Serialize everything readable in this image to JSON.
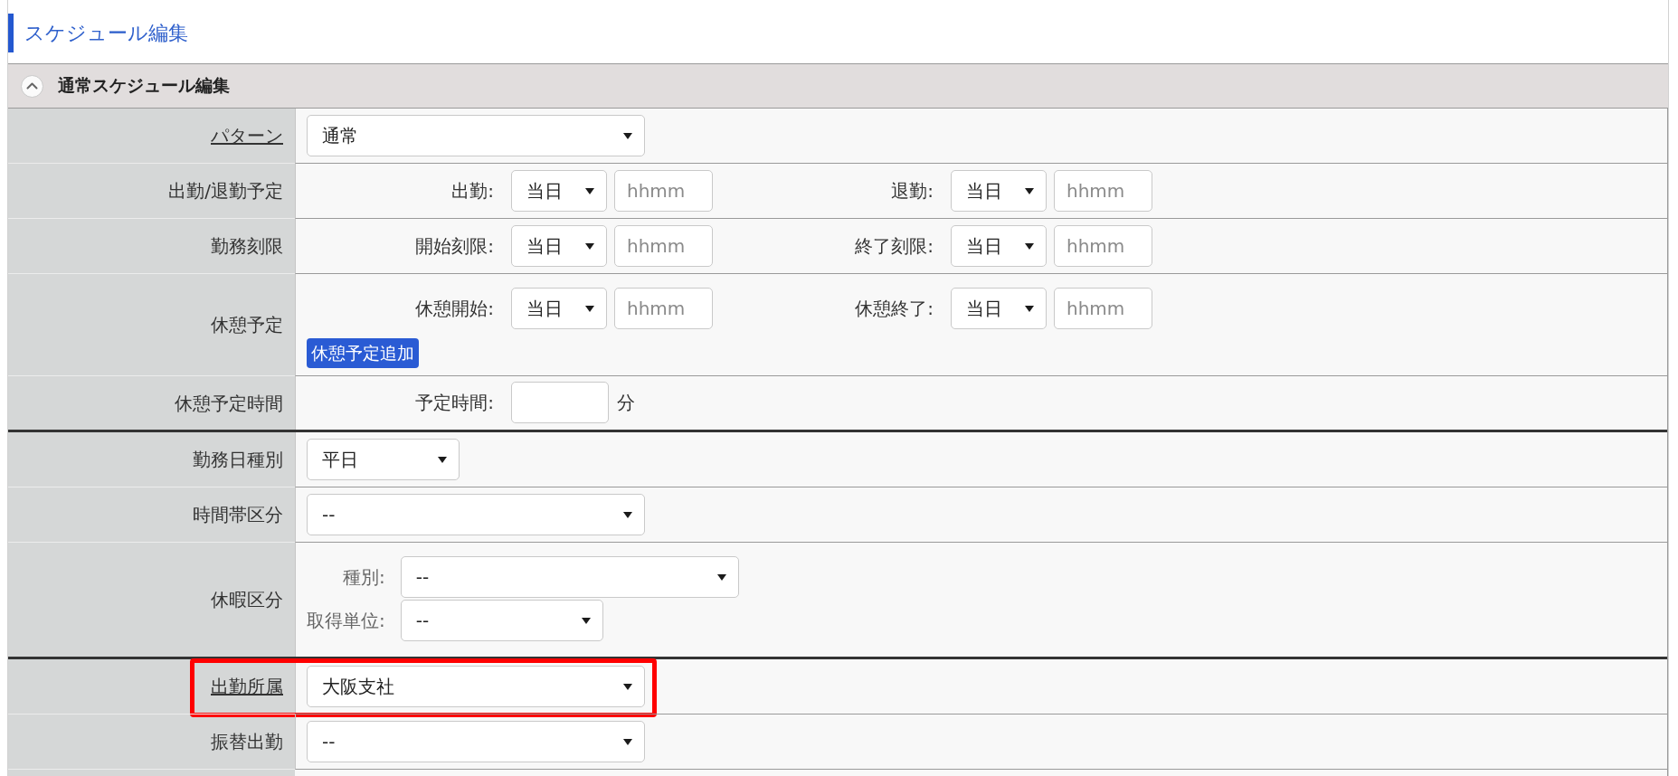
{
  "page_title": "スケジュール編集",
  "section": {
    "title": "通常スケジュール編集",
    "expanded": true,
    "groups": [
      {
        "rows": [
          {
            "kind": "select",
            "label": "パターン",
            "link": true,
            "highlighted": false,
            "value": "通常"
          },
          {
            "kind": "times",
            "label": "出勤/退勤予定",
            "link": false,
            "highlighted": false,
            "pairs": [
              {
                "label": "出勤:",
                "day": "当日",
                "placeholder": "hhmm"
              },
              {
                "label": "退勤:",
                "day": "当日",
                "placeholder": "hhmm"
              }
            ]
          },
          {
            "kind": "times",
            "label": "勤務刻限",
            "link": false,
            "highlighted": false,
            "pairs": [
              {
                "label": "開始刻限:",
                "day": "当日",
                "placeholder": "hhmm"
              },
              {
                "label": "終了刻限:",
                "day": "当日",
                "placeholder": "hhmm"
              }
            ]
          },
          {
            "kind": "times",
            "label": "休憩予定",
            "link": false,
            "highlighted": false,
            "pairs": [
              {
                "label": "休憩開始:",
                "day": "当日",
                "placeholder": "hhmm"
              },
              {
                "label": "休憩終了:",
                "day": "当日",
                "placeholder": "hhmm"
              }
            ],
            "button": "休憩予定追加"
          },
          {
            "kind": "minutes",
            "label": "休憩予定時間",
            "link": false,
            "highlighted": false,
            "field_label": "予定時間:",
            "unit": "分"
          }
        ]
      },
      {
        "rows": [
          {
            "kind": "short_select",
            "label": "勤務日種別",
            "link": false,
            "highlighted": false,
            "value": "平日"
          },
          {
            "kind": "select",
            "label": "時間帯区分",
            "link": false,
            "highlighted": false,
            "value": "--"
          },
          {
            "kind": "leave",
            "label": "休暇区分",
            "link": false,
            "highlighted": false,
            "fields": [
              {
                "label": "種別:",
                "value": "--"
              },
              {
                "label": "取得単位:",
                "value": "--"
              }
            ]
          }
        ]
      },
      {
        "rows": [
          {
            "kind": "select",
            "label": "出勤所属",
            "link": true,
            "highlighted": true,
            "value": "大阪支社"
          },
          {
            "kind": "select",
            "label": "振替出勤",
            "link": false,
            "highlighted": false,
            "value": "--"
          }
        ]
      }
    ]
  }
}
